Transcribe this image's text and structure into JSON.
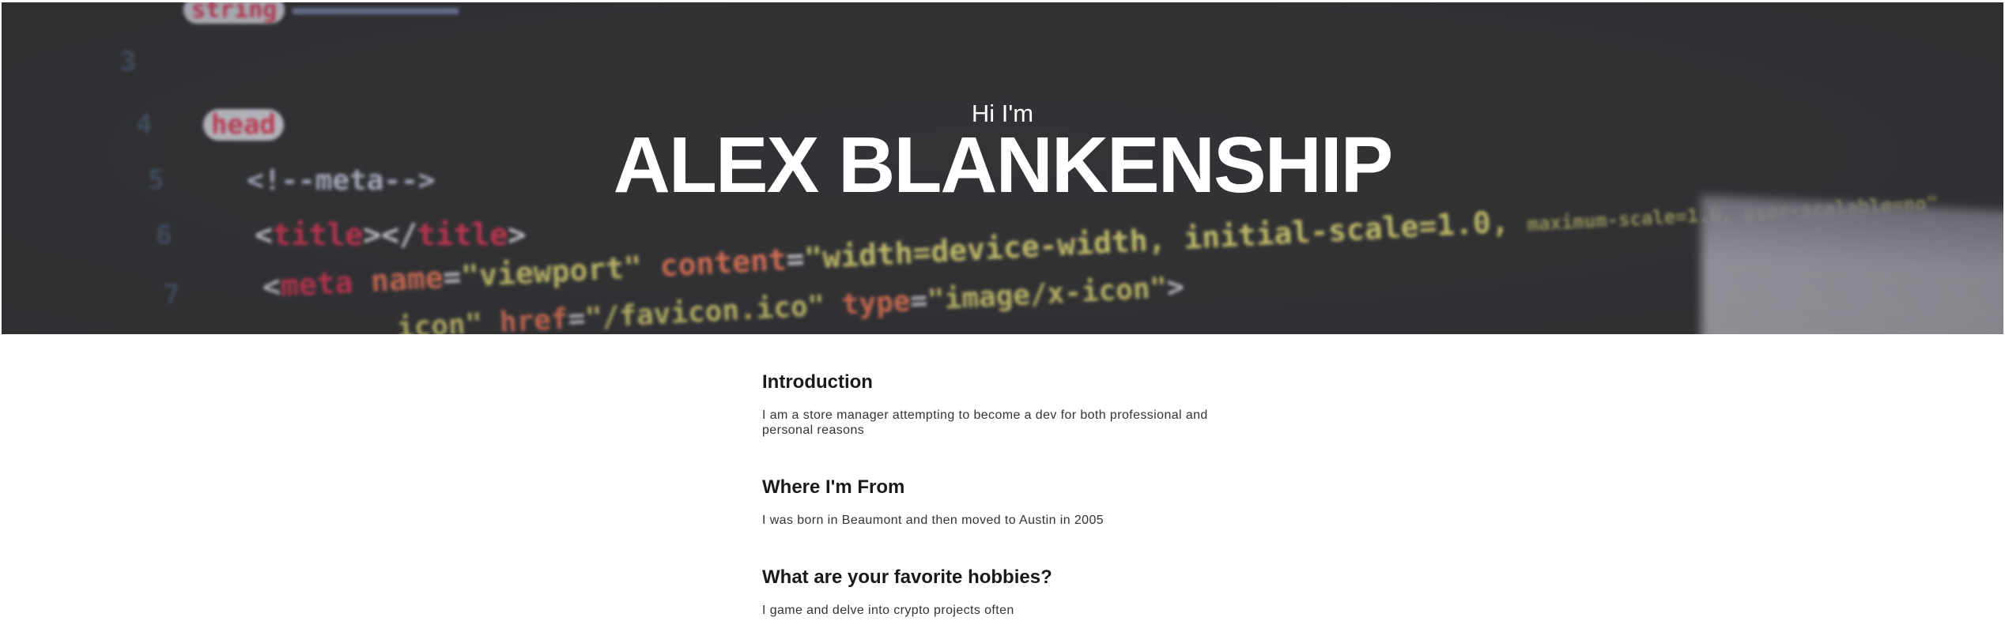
{
  "hero": {
    "greeting": "Hi I'm",
    "name": "ALEX BLANKENSHIP"
  },
  "sections": [
    {
      "heading": "Introduction",
      "body": "I am a store manager attempting to become a dev for both professional and personal reasons"
    },
    {
      "heading": "Where I'm From",
      "body": "I was born in Beaumont and then moved to Austin in 2005"
    },
    {
      "heading": "What are your favorite hobbies?",
      "body": "I game and delve into crypto projects often"
    }
  ],
  "colors": {
    "hero_background": "#333336",
    "text": "#1a1a1a"
  }
}
